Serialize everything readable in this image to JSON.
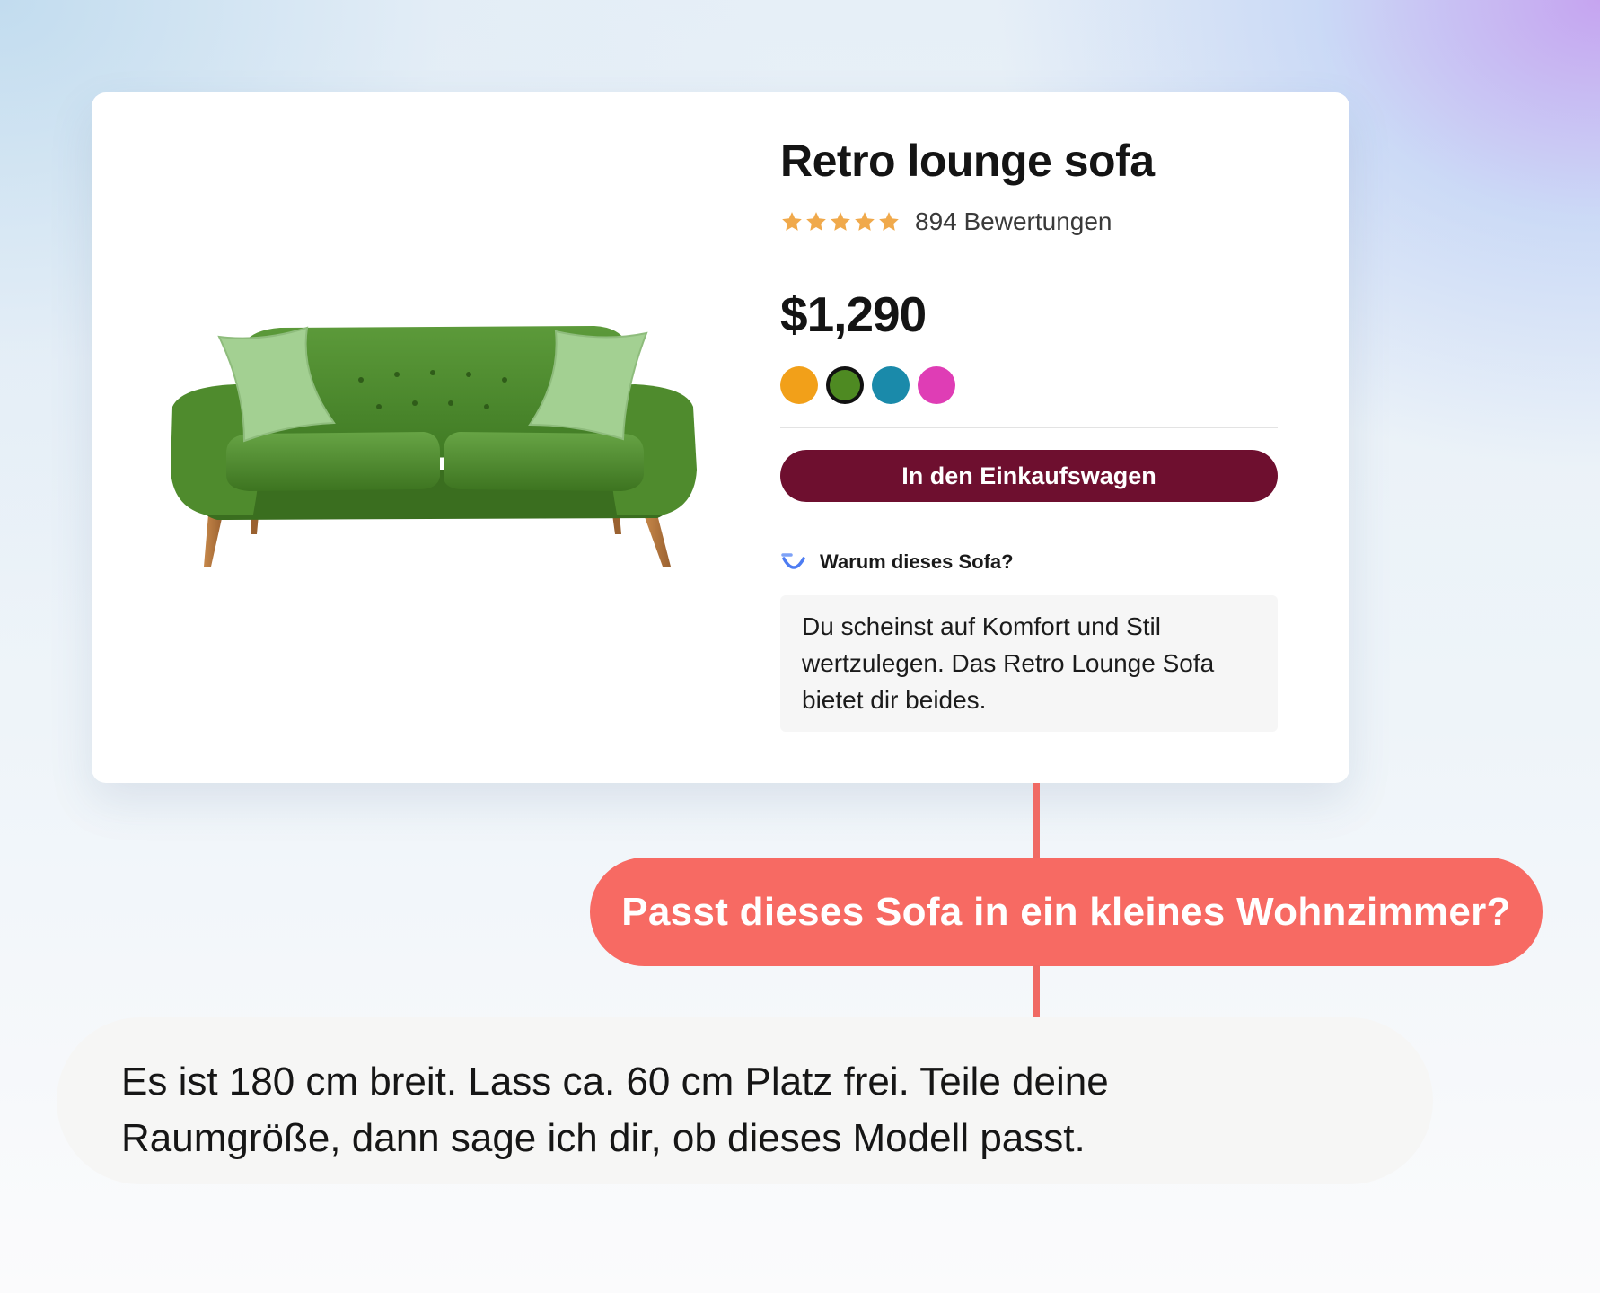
{
  "product": {
    "title": "Retro lounge sofa",
    "rating": {
      "stars": 5,
      "count_label": "894 Bewertungen"
    },
    "price": "$1,290",
    "image_icon": "sofa-image",
    "colors": [
      {
        "name": "orange",
        "hex": "#F2A019",
        "selected": false
      },
      {
        "name": "green",
        "hex": "#4E8A22",
        "selected": true
      },
      {
        "name": "teal",
        "hex": "#1A8AAA",
        "selected": false
      },
      {
        "name": "pink",
        "hex": "#DF3DB5",
        "selected": false
      }
    ],
    "add_to_cart_label": "In den Einkaufswagen",
    "why": {
      "icon": "ai-sparkle-icon",
      "label": "Warum dieses Sofa?",
      "text": "Du scheinst auf Komfort und Stil wertzulegen. Das Retro Lounge Sofa bietet dir beides."
    }
  },
  "chat": {
    "question": "Passt dieses Sofa in ein kleines Wohnzimmer?",
    "answer_line1": "Es ist 180 cm breit. Lass ca. 60 cm Platz frei. Teile deine",
    "answer_line2": "Raumgröße, dann sage ich dir, ob dieses Modell passt."
  },
  "colors": {
    "cart_button": "#6E0F2F",
    "question_bubble": "#F76A63",
    "star": "#F0A94B",
    "accent_icon": "#4D7CF2"
  }
}
